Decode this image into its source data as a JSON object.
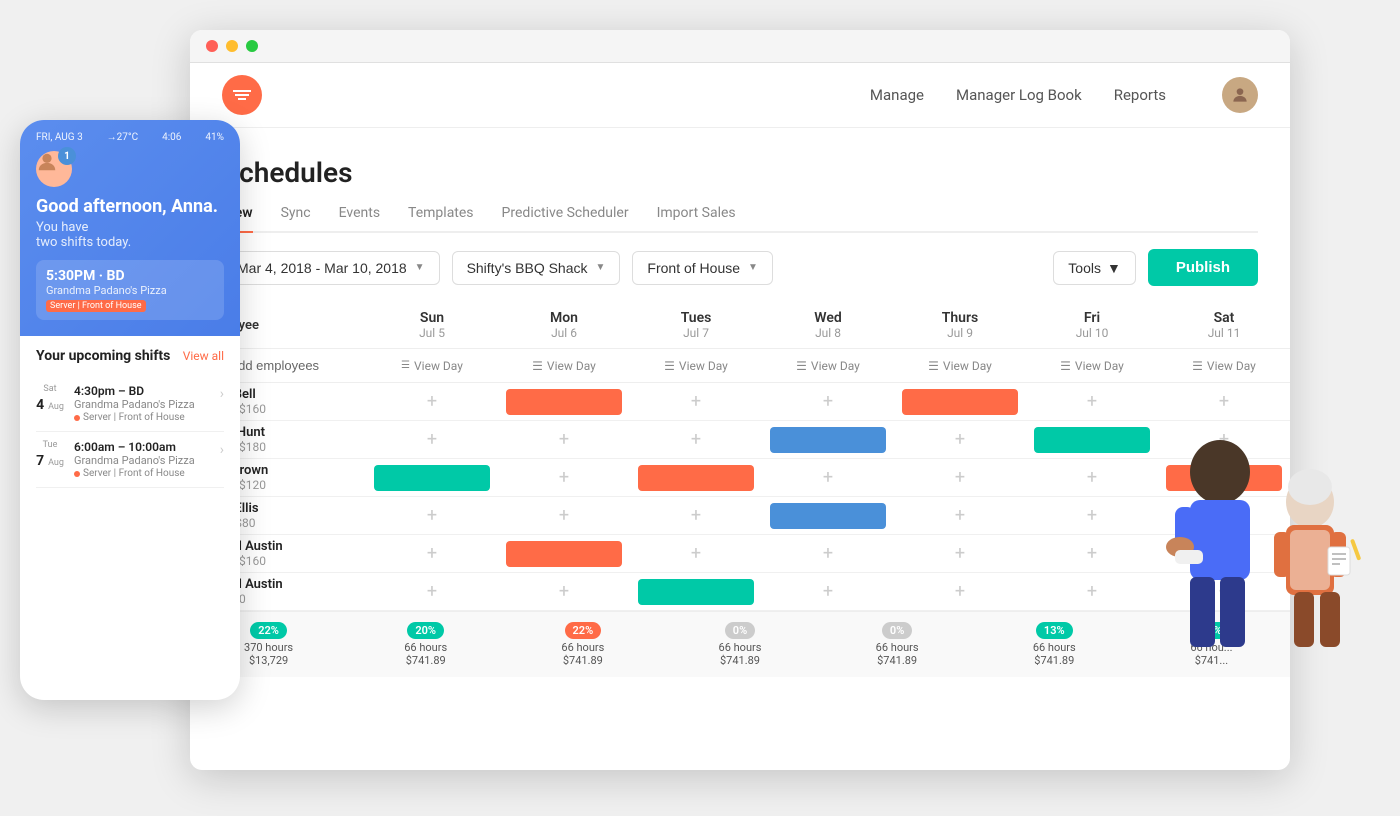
{
  "browser": {
    "dots": [
      "red",
      "yellow",
      "green"
    ]
  },
  "header": {
    "nav": {
      "manage": "Manage",
      "manager_log_book": "Manager Log Book",
      "reports": "Reports"
    }
  },
  "page": {
    "title": "Schedules",
    "tabs": [
      {
        "label": "View",
        "active": true
      },
      {
        "label": "Sync",
        "active": false
      },
      {
        "label": "Events",
        "active": false
      },
      {
        "label": "Templates",
        "active": false
      },
      {
        "label": "Predictive Scheduler",
        "active": false
      },
      {
        "label": "Import Sales",
        "active": false
      }
    ]
  },
  "toolbar": {
    "date_range": "Mar 4, 2018 - Mar 10, 2018",
    "location": "Shifty's BBQ Shack",
    "department": "Front of House",
    "tools": "Tools",
    "publish": "Publish"
  },
  "schedule": {
    "columns": {
      "employee": "Employee",
      "days": [
        {
          "name": "Sun",
          "date": "Jul 5"
        },
        {
          "name": "Mon",
          "date": "Jul 6"
        },
        {
          "name": "Tues",
          "date": "Jul 7"
        },
        {
          "name": "Wed",
          "date": "Jul 8"
        },
        {
          "name": "Thurs",
          "date": "Jul 9"
        },
        {
          "name": "Fri",
          "date": "Jul 10"
        },
        {
          "name": "Sat",
          "date": "Jul 11"
        }
      ]
    },
    "add_employees_label": "Add employees",
    "view_day_label": "View Day",
    "employees": [
      {
        "name": "David Bell",
        "hours": "16/40 · $160",
        "shifts": [
          null,
          "orange",
          null,
          null,
          "orange",
          null,
          null
        ]
      },
      {
        "name": "Jacob Hunt",
        "hours": "18/40 · $180",
        "shifts": [
          null,
          null,
          null,
          "blue",
          null,
          "teal",
          null
        ]
      },
      {
        "name": "Keith Brown",
        "hours": "12/40 · $120",
        "shifts": [
          "teal",
          null,
          "orange",
          null,
          null,
          null,
          "orange"
        ]
      },
      {
        "name": "Ethan Ellis",
        "hours": "8/ 40 · $80",
        "shifts": [
          null,
          null,
          null,
          "blue",
          null,
          null,
          null
        ]
      },
      {
        "name": "Samuel Austin",
        "hours": "16/40 · $160",
        "shifts": [
          null,
          "orange",
          null,
          null,
          null,
          null,
          null
        ]
      },
      {
        "name": "Samuel Austin",
        "hours": "0/40 · $0",
        "shifts": [
          null,
          null,
          "teal",
          null,
          null,
          null,
          null
        ]
      }
    ]
  },
  "stats": [
    {
      "percent": "22%",
      "hours": "370 hours",
      "cost": "$13,729",
      "color": "teal"
    },
    {
      "percent": "20%",
      "hours": "66 hours",
      "cost": "$741.89",
      "color": "teal"
    },
    {
      "percent": "22%",
      "hours": "66 hours",
      "cost": "$741.89",
      "color": "orange"
    },
    {
      "percent": "0%",
      "hours": "66 hours",
      "cost": "$741.89",
      "color": "gray"
    },
    {
      "percent": "0%",
      "hours": "66 hours",
      "cost": "$741.89",
      "color": "gray"
    },
    {
      "percent": "13%",
      "hours": "66 hours",
      "cost": "$741.89",
      "color": "teal"
    },
    {
      "percent": "15%",
      "hours": "66 hou...",
      "cost": "$741...",
      "color": "teal"
    }
  ],
  "phone": {
    "status_bar": {
      "date": "FRI, AUG 3",
      "temp": "→27°C",
      "time": "4:06",
      "battery": "41%"
    },
    "greeting": "Good afternoon, Anna.",
    "subtext": "You have\ntwo shifts today.",
    "shift": {
      "time": "5:30PM · BD",
      "location": "Grandma Padano's Pizza",
      "role": "Server | Front of House"
    },
    "upcoming_title": "Your upcoming shifts",
    "view_all": "View all",
    "notification_count": "1",
    "shifts": [
      {
        "day_label": "Sat",
        "day_num": "4",
        "month": "Aug",
        "time": "4:30pm – BD",
        "location": "Grandma Padano's Pizza",
        "role": "Server | Front of House"
      },
      {
        "day_label": "Tue",
        "day_num": "7",
        "month": "Aug",
        "time": "6:00am – 10:00am",
        "location": "Grandma Padano's Pizza",
        "role": "Server | Front of House"
      }
    ]
  }
}
